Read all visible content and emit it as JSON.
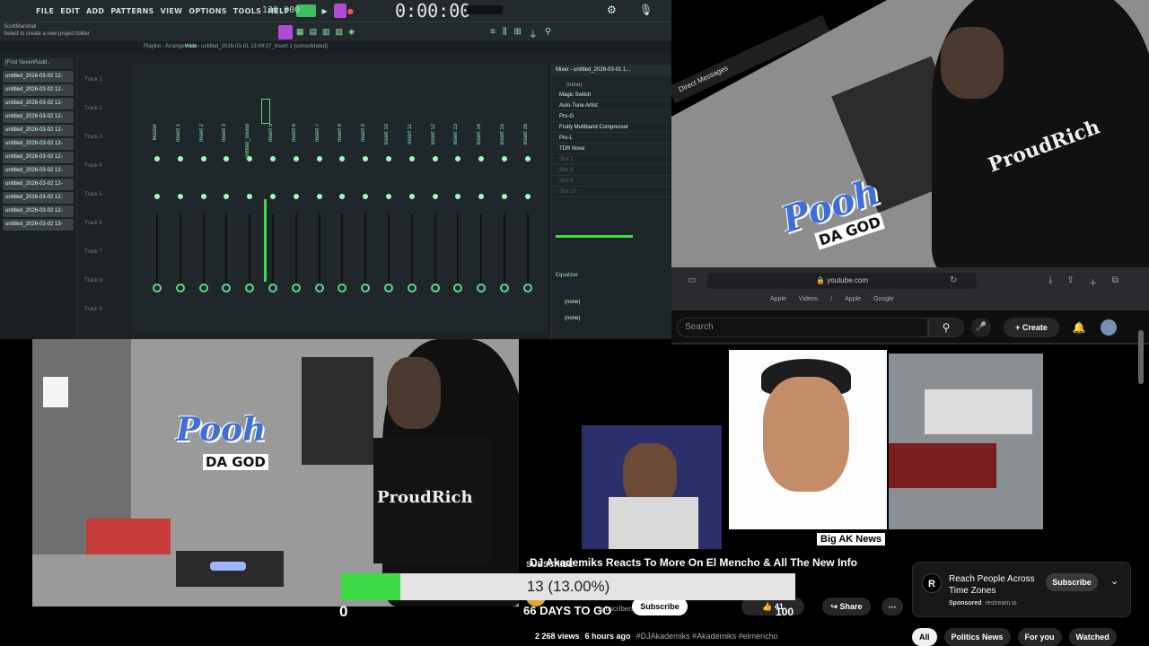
{
  "fl_studio": {
    "menu": [
      "FILE",
      "EDIT",
      "ADD",
      "PATTERNS",
      "VIEW",
      "OPTIONS",
      "TOOLS",
      "HELP"
    ],
    "bpm": "130.000",
    "time": "0:00:00",
    "hint_line1": "ScottMarshall",
    "hint_line2": "Select to create a new project folder",
    "playlist_path": "Playlist - Arrangement › untitled_2026-03-01 13:49:07_Insert 1 (consolidated)",
    "mixer_title": "Mixer - untitled_2026-03-01 1...",
    "wide_label": "Wide",
    "browser_header": "[Find SevenRadd..",
    "browser_items": [
      "untitled_2026-03-02 12-",
      "untitled_2026-03-02 12-",
      "untitled_2026-03-02 12-",
      "untitled_2026-03-02 12-",
      "untitled_2026-03-02 12-",
      "untitled_2026-03-02 12-",
      "untitled_2026-03-02 12-",
      "untitled_2026-03-02 12-",
      "untitled_2026-03-02 12-",
      "untitled_2026-03-02 12-",
      "untitled_2026-03-02 12-",
      "untitled_2026-03-02 13-"
    ],
    "tracks": [
      "Track 1",
      "Track 2",
      "Track 3",
      "Track 4",
      "Track 5",
      "Track 6",
      "Track 7",
      "Track 8",
      "Track 9"
    ],
    "strips": [
      "Master",
      "Insert 1",
      "Insert 2",
      "Insert 3",
      "untitled_sound",
      "Insert 5",
      "Insert 6",
      "Insert 7",
      "Insert 8",
      "Insert 9",
      "Insert 10",
      "Insert 11",
      "Insert 12",
      "Insert 13",
      "Insert 14",
      "Insert 15",
      "Insert 16"
    ],
    "fx_header": "(none)",
    "fx_slots": [
      "Magic Switch",
      "Auto-Tune Artist",
      "Pro-G",
      "Fruity Multiband Compressor",
      "Pro-L",
      "TDR Nova",
      "Slot 7",
      "Slot 8",
      "Slot 9",
      "Slot 10"
    ],
    "equalizer_label": "Equalizer",
    "fx_footer_1": "(none)",
    "fx_footer_2": "(none)"
  },
  "webcam_top": {
    "header": "Direct Messages",
    "logo_main": "Pooh",
    "logo_sub": "DA GOD",
    "hoodie_text": "ProudRich"
  },
  "browser": {
    "url": "youtube.com",
    "bookmarks": [
      "Apple",
      "Videos",
      "/",
      "Apple",
      "Google"
    ]
  },
  "youtube": {
    "search_placeholder": "Search",
    "create_label": "Create",
    "badge": "Big AK News",
    "title": "DJ Akademiks Reacts To More On El Mencho & All The New Info",
    "channel": "SUBSCRIBE",
    "subscribers": "subscribers",
    "subscribe_label": "Subscribe",
    "likes": "41",
    "share_label": "Share",
    "views": "2 268 views",
    "age": "6 hours ago",
    "hashtags": "#DJAkademiks #Akademiks #elmencho",
    "ad_title": "Reach People Across Time Zones",
    "ad_sponsor": "Sponsored",
    "ad_domain": "restream.io",
    "ad_button": "Subscribe",
    "chips": [
      "All",
      "Politics News",
      "For you",
      "Watched"
    ]
  },
  "webcam_bottom": {
    "logo_main": "Pooh",
    "logo_sub": "DA GOD",
    "hoodie_text": "ProudRich"
  },
  "overlay": {
    "progress_text": "13 (13.00%)",
    "progress_fraction": 0.13,
    "min_label": "0",
    "max_label": "100",
    "days_left": "66 DAYS TO GO"
  }
}
